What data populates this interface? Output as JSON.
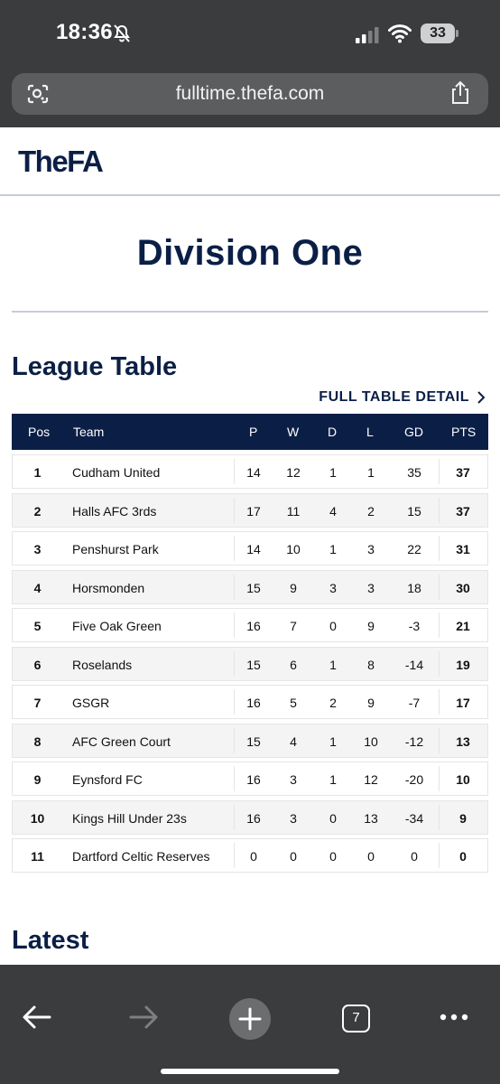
{
  "status_bar": {
    "time": "18:36",
    "battery": "33"
  },
  "browser": {
    "url": "fulltime.thefa.com",
    "tab_count": "7"
  },
  "site": {
    "logo": "TheFA"
  },
  "page": {
    "division_title": "Division One",
    "league_table_title": "League Table",
    "full_table_link": "FULL TABLE DETAIL",
    "latest_title": "Latest"
  },
  "table": {
    "headers": {
      "pos": "Pos",
      "team": "Team",
      "p": "P",
      "w": "W",
      "d": "D",
      "l": "L",
      "gd": "GD",
      "pts": "PTS"
    },
    "rows": [
      {
        "pos": "1",
        "team": "Cudham United",
        "p": "14",
        "w": "12",
        "d": "1",
        "l": "1",
        "gd": "35",
        "pts": "37"
      },
      {
        "pos": "2",
        "team": "Halls AFC 3rds",
        "p": "17",
        "w": "11",
        "d": "4",
        "l": "2",
        "gd": "15",
        "pts": "37"
      },
      {
        "pos": "3",
        "team": "Penshurst Park",
        "p": "14",
        "w": "10",
        "d": "1",
        "l": "3",
        "gd": "22",
        "pts": "31"
      },
      {
        "pos": "4",
        "team": "Horsmonden",
        "p": "15",
        "w": "9",
        "d": "3",
        "l": "3",
        "gd": "18",
        "pts": "30"
      },
      {
        "pos": "5",
        "team": "Five Oak Green",
        "p": "16",
        "w": "7",
        "d": "0",
        "l": "9",
        "gd": "-3",
        "pts": "21"
      },
      {
        "pos": "6",
        "team": "Roselands",
        "p": "15",
        "w": "6",
        "d": "1",
        "l": "8",
        "gd": "-14",
        "pts": "19"
      },
      {
        "pos": "7",
        "team": "GSGR",
        "p": "16",
        "w": "5",
        "d": "2",
        "l": "9",
        "gd": "-7",
        "pts": "17"
      },
      {
        "pos": "8",
        "team": "AFC Green Court",
        "p": "15",
        "w": "4",
        "d": "1",
        "l": "10",
        "gd": "-12",
        "pts": "13"
      },
      {
        "pos": "9",
        "team": "Eynsford FC",
        "p": "16",
        "w": "3",
        "d": "1",
        "l": "12",
        "gd": "-20",
        "pts": "10"
      },
      {
        "pos": "10",
        "team": "Kings Hill Under 23s",
        "p": "16",
        "w": "3",
        "d": "0",
        "l": "13",
        "gd": "-34",
        "pts": "9"
      },
      {
        "pos": "11",
        "team": "Dartford Celtic Reserves",
        "p": "0",
        "w": "0",
        "d": "0",
        "l": "0",
        "gd": "0",
        "pts": "0"
      }
    ]
  },
  "colors": {
    "navy": "#0b1f46",
    "chrome": "#3a3c3e",
    "row_alt": "#f4f4f5"
  },
  "icons": [
    "bell-slash-icon",
    "signal-icon",
    "wifi-icon",
    "lens-icon",
    "share-icon",
    "chevron-right-icon",
    "back-arrow-icon",
    "forward-arrow-icon",
    "new-tab-icon",
    "tabs-icon",
    "more-icon"
  ]
}
